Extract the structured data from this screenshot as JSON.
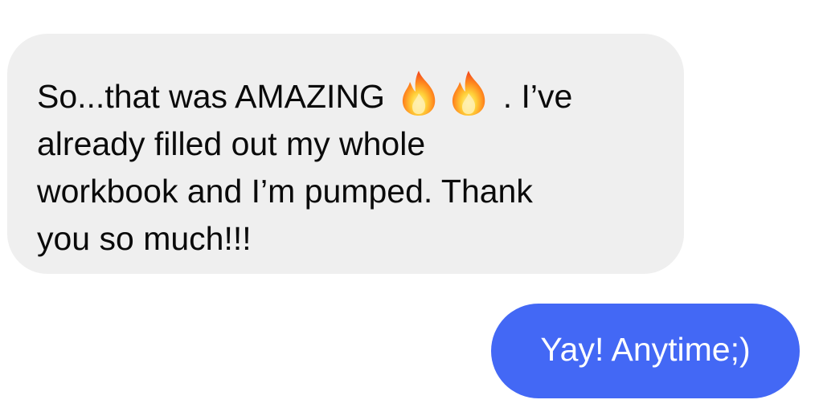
{
  "incoming_message": {
    "line_1_before_emoji": "So...that was AMAZING ",
    "line_1_after_emoji": " . I’ve",
    "line_2": "already filled out my whole",
    "line_3": "workbook and I’m pumped. Thank",
    "line_4": "you so much!!!",
    "emojis": [
      "fire-icon",
      "fire-icon"
    ],
    "bubble_color": "#efefef",
    "text_color": "#0a0a0a"
  },
  "outgoing_message": {
    "text": "Yay! Anytime;)",
    "bubble_color": "#4368f5",
    "text_color": "#ffffff"
  }
}
